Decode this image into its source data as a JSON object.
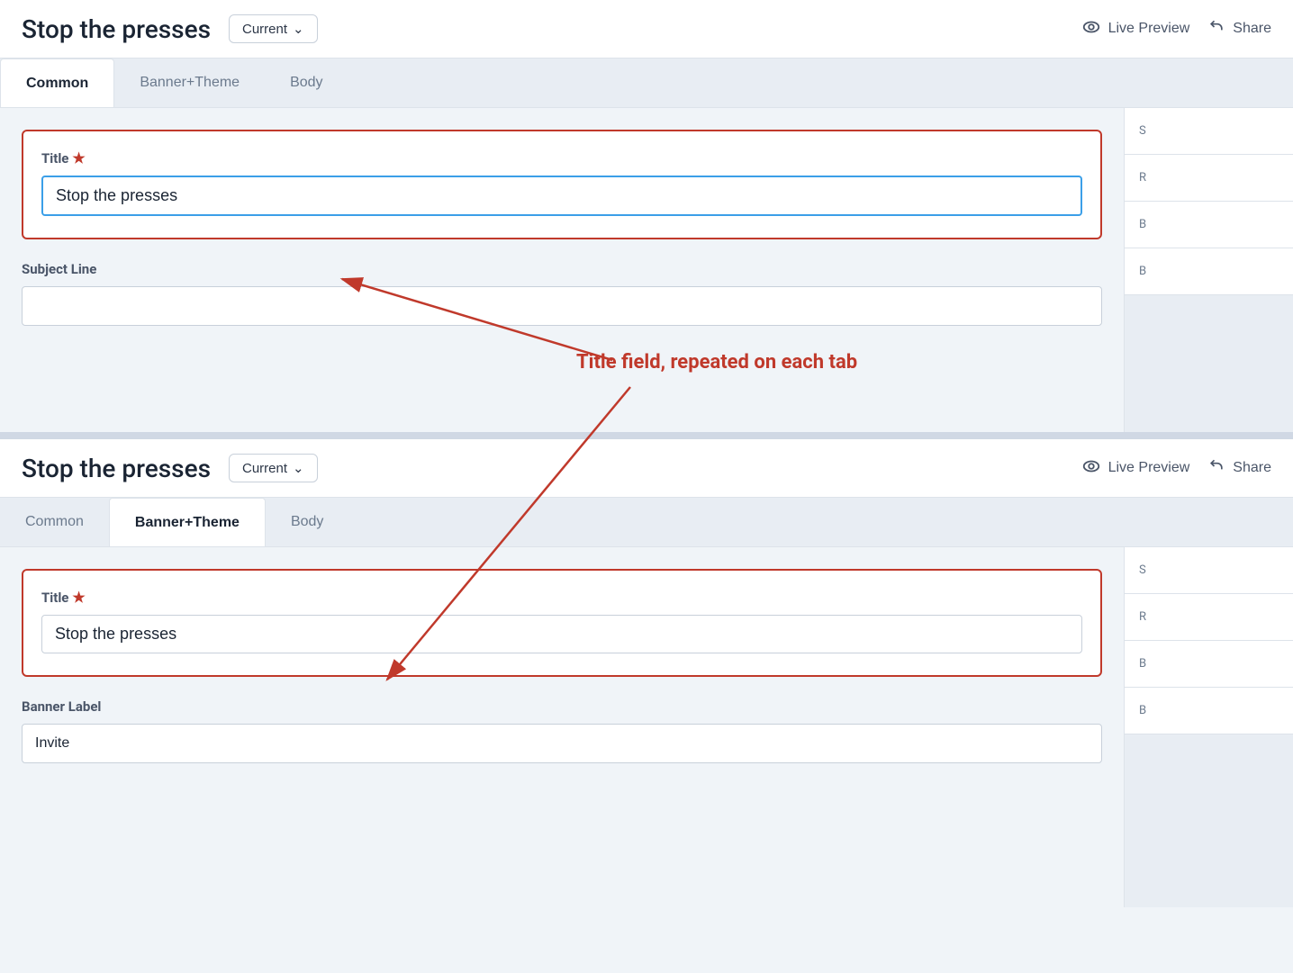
{
  "panel1": {
    "title": "Stop the presses",
    "version_label": "Current",
    "version_caret": "∨",
    "live_preview_label": "Live Preview",
    "share_label": "Share",
    "tabs": [
      {
        "id": "common",
        "label": "Common",
        "active": true
      },
      {
        "id": "banner_theme",
        "label": "Banner+Theme",
        "active": false
      },
      {
        "id": "body",
        "label": "Body",
        "active": false
      }
    ],
    "title_field": {
      "label": "Title",
      "required": true,
      "value": "Stop the presses"
    },
    "subject_line_field": {
      "label": "Subject Line",
      "placeholder": ""
    },
    "sidebar_items": [
      "S",
      "R",
      "B",
      "B"
    ]
  },
  "panel2": {
    "title": "Stop the presses",
    "version_label": "Current",
    "version_caret": "∨",
    "live_preview_label": "Live Preview",
    "share_label": "Share",
    "tabs": [
      {
        "id": "common",
        "label": "Common",
        "active": false
      },
      {
        "id": "banner_theme",
        "label": "Banner+Theme",
        "active": true
      },
      {
        "id": "body",
        "label": "Body",
        "active": false
      }
    ],
    "title_field": {
      "label": "Title",
      "required": true,
      "value": "Stop the presses"
    },
    "banner_label_field": {
      "label": "Banner Label",
      "value": "Invite"
    },
    "sidebar_items": [
      "S",
      "R",
      "B",
      "B"
    ]
  },
  "annotation": {
    "text": "Title field, repeated on each tab",
    "arrow1_from": "input1",
    "arrow1_to": "input2"
  }
}
